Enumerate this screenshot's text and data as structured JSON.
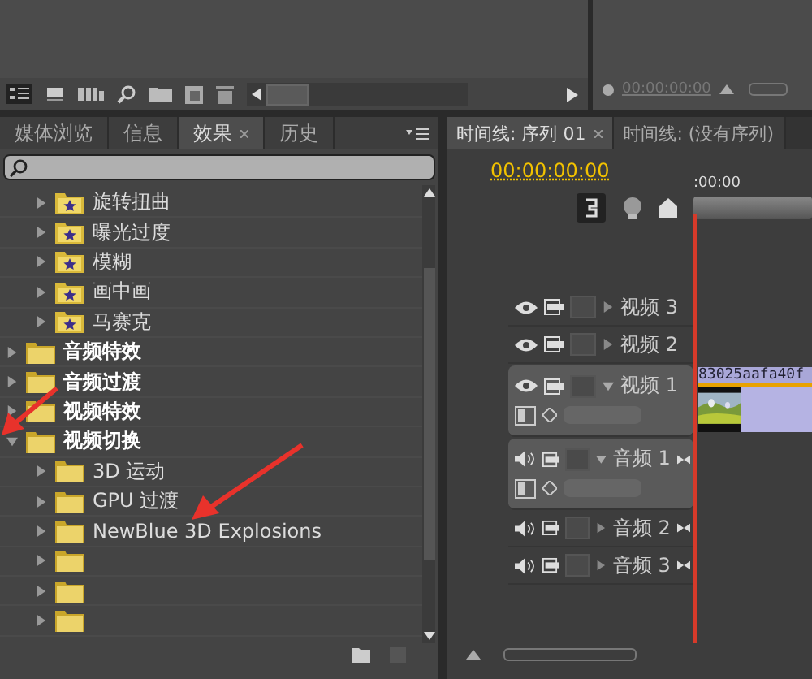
{
  "program_monitor": {
    "timecode": "00:00:00:00"
  },
  "effects_panel": {
    "tabs": [
      {
        "label": "媒体浏览",
        "selected": false,
        "closable": false
      },
      {
        "label": "信息",
        "selected": false,
        "closable": false
      },
      {
        "label": "效果",
        "selected": true,
        "closable": true
      },
      {
        "label": "历史",
        "selected": false,
        "closable": false
      }
    ],
    "tree": [
      {
        "children": [
          {
            "label": "旋转扭曲",
            "kind": "preset",
            "expanded": false
          },
          {
            "label": "曝光过度",
            "kind": "preset",
            "expanded": false
          },
          {
            "label": "模糊",
            "kind": "preset",
            "expanded": false
          },
          {
            "label": "画中画",
            "kind": "preset",
            "expanded": false
          },
          {
            "label": "马赛克",
            "kind": "preset",
            "expanded": false
          }
        ]
      },
      {
        "label": "音频特效",
        "kind": "folder",
        "expanded": false
      },
      {
        "label": "音频过渡",
        "kind": "folder",
        "expanded": false
      },
      {
        "label": "视频特效",
        "kind": "folder",
        "expanded": false
      },
      {
        "label": "视频切换",
        "kind": "folder",
        "expanded": true,
        "pointed_at": true,
        "children": [
          {
            "label": "3D 运动",
            "kind": "folder",
            "expanded": false
          },
          {
            "label": "GPU 过渡",
            "kind": "folder",
            "expanded": false
          },
          {
            "label": "NewBlue 3D Explosions",
            "kind": "folder",
            "expanded": false,
            "pointed_at": true
          },
          {
            "kind": "folder",
            "expanded": false
          },
          {
            "kind": "folder",
            "expanded": false
          },
          {
            "kind": "folder",
            "expanded": false
          }
        ]
      }
    ]
  },
  "timeline": {
    "tabs": [
      {
        "label": "时间线: 序列 01",
        "selected": true,
        "closable": true
      },
      {
        "label": "时间线: (没有序列)",
        "selected": false,
        "closable": false
      }
    ],
    "timecode": "00:00:00:00",
    "ruler_label": ":00:00",
    "tracks": [
      {
        "name": "视频 3",
        "kind": "video",
        "expanded": false
      },
      {
        "name": "视频 2",
        "kind": "video",
        "expanded": false
      },
      {
        "name": "视频 1",
        "kind": "video",
        "expanded": true,
        "clip": "83025aafa40f"
      },
      {
        "name": "音频 1",
        "kind": "audio",
        "expanded": true
      },
      {
        "name": "音频 2",
        "kind": "audio",
        "expanded": false
      },
      {
        "name": "音频 3",
        "kind": "audio",
        "expanded": false
      }
    ]
  }
}
